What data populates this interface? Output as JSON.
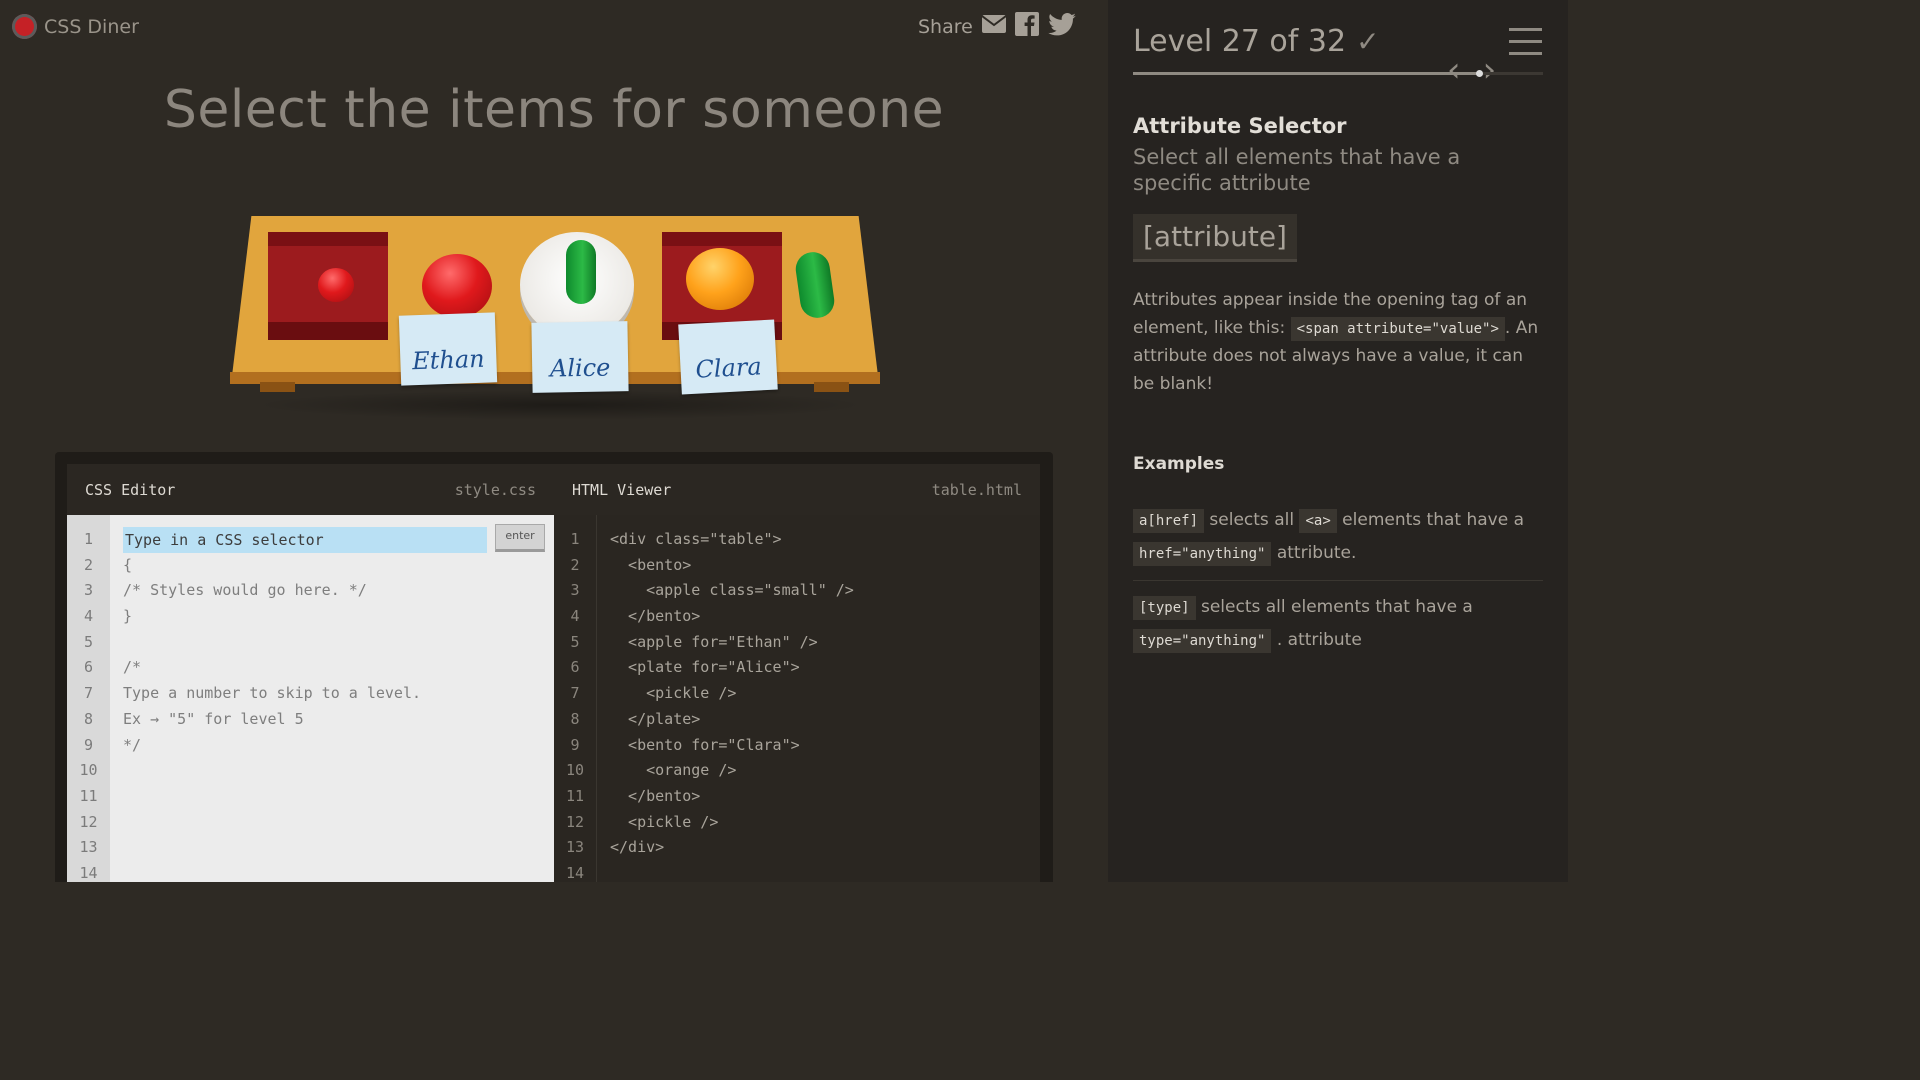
{
  "app": {
    "name": "CSS Diner"
  },
  "share": {
    "label": "Share",
    "icons": [
      "mail-icon",
      "facebook-icon",
      "twitter-icon"
    ]
  },
  "instruction": "Select the items for someone",
  "scene": {
    "items": [
      {
        "type": "bento",
        "contains": "small apple"
      },
      {
        "type": "apple",
        "for": "Ethan"
      },
      {
        "type": "plate",
        "for": "Alice",
        "contains": "pickle"
      },
      {
        "type": "bento",
        "for": "Clara",
        "contains": "orange"
      },
      {
        "type": "pickle"
      }
    ],
    "name_tags": [
      "Ethan",
      "Alice",
      "Clara"
    ]
  },
  "css_editor": {
    "title": "CSS Editor",
    "file": "style.css",
    "placeholder": "Type in a CSS selector",
    "enter_label": "enter",
    "line_numbers": [
      "1",
      "2",
      "3",
      "4",
      "5",
      "6",
      "7",
      "8",
      "9",
      "10",
      "11",
      "12",
      "13",
      "14"
    ],
    "lines": [
      "",
      "{",
      "/* Styles would go here. */",
      "}",
      "",
      "/*",
      "Type a number to skip to a level.",
      "Ex → \"5\" for level 5",
      "*/",
      "",
      "",
      "",
      "",
      ""
    ]
  },
  "html_viewer": {
    "title": "HTML Viewer",
    "file": "table.html",
    "line_numbers": [
      "1",
      "2",
      "3",
      "4",
      "5",
      "6",
      "7",
      "8",
      "9",
      "10",
      "11",
      "12",
      "13",
      "14"
    ],
    "lines": [
      "<div class=\"table\">",
      "  <bento>",
      "    <apple class=\"small\" />",
      "  </bento>",
      "  <apple for=\"Ethan\" />",
      "  <plate for=\"Alice\">",
      "    <pickle />",
      "  </plate>",
      "  <bento for=\"Clara\">",
      "    <orange />",
      "  </bento>",
      "  <pickle />",
      "</div>",
      ""
    ]
  },
  "sidebar": {
    "level_label": "Level 27 of 32",
    "level_current": 27,
    "level_total": 32,
    "completed": true,
    "selector_name": "Attribute Selector",
    "selector_desc": "Select all elements that have a specific attribute",
    "syntax": "[attribute]",
    "description_parts": {
      "before": "Attributes appear inside the opening tag of an element, like this: ",
      "code": "<span attribute=\"value\">",
      "after": ". An attribute does not always have a value, it can be blank!"
    },
    "examples_title": "Examples",
    "examples": [
      {
        "selector": "a[href]",
        "text1": "selects all",
        "tag": "<a>",
        "text2": "elements that have a",
        "code2": "href=\"anything\"",
        "text3": "attribute."
      },
      {
        "selector": "[type]",
        "text1": "selects all elements that have a",
        "code2": "type=\"anything\"",
        "text3": ". attribute"
      }
    ]
  }
}
